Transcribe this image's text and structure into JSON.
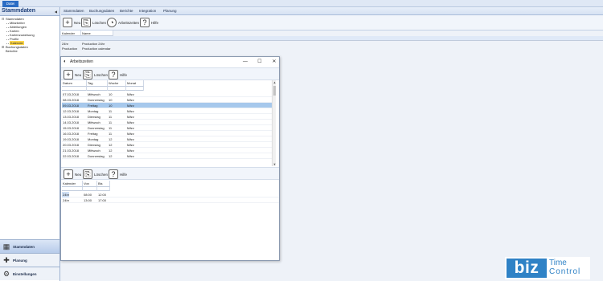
{
  "app": {
    "file_tab": "Datei"
  },
  "nav": {
    "title": "Stammdaten",
    "tree": [
      {
        "label": "Stammdaten",
        "level": 0,
        "expander": "⊟"
      },
      {
        "label": "Mitarbeiter",
        "level": 1
      },
      {
        "label": "Abteilungen",
        "level": 1
      },
      {
        "label": "Karten",
        "level": 1
      },
      {
        "label": "Kartenzuweisung",
        "level": 1
      },
      {
        "label": "Profile",
        "level": 1
      },
      {
        "label": "Kalender",
        "level": 1,
        "selected": true
      },
      {
        "label": "Buchungsdaten",
        "level": 0,
        "expander": "⊞"
      },
      {
        "label": "Berichte",
        "level": 0
      }
    ],
    "buttons": [
      {
        "label": "Stammdaten",
        "icon": "master-data-icon",
        "active": true
      },
      {
        "label": "Planung",
        "icon": "planning-icon"
      },
      {
        "label": "Einstellungen",
        "icon": "settings-icon"
      }
    ]
  },
  "menu": [
    "Stammdaten",
    "Buchungsdaten",
    "Berichte",
    "Integration",
    "Planung"
  ],
  "toolbar": {
    "new_label": "Neu",
    "delete_label": "Löschen",
    "worktimes_label": "Arbeitszeiten",
    "help_label": "Hilfe"
  },
  "grid": {
    "columns": [
      "Kalender",
      "Name"
    ],
    "rows": [
      [
        "24hr",
        "Production 24hr"
      ],
      [
        "Production",
        "Production calendar"
      ]
    ]
  },
  "dialog": {
    "title": "Arbeitszeiten",
    "toolbar": {
      "new_label": "Neu",
      "delete_label": "Löschen",
      "help_label": "Hilfe"
    },
    "days": {
      "columns": [
        "Datum",
        "Tag",
        "Woche",
        "Monat"
      ],
      "rows": [
        [
          "07.03.2018",
          "Mittwoch",
          "10",
          "März"
        ],
        [
          "08.03.2018",
          "Donnerstag",
          "10",
          "März"
        ],
        [
          "09.03.2018",
          "Freitag",
          "10",
          "März"
        ],
        [
          "12.03.2018",
          "Montag",
          "11",
          "März"
        ],
        [
          "13.03.2018",
          "Dienstag",
          "11",
          "März"
        ],
        [
          "14.03.2018",
          "Mittwoch",
          "11",
          "März"
        ],
        [
          "15.03.2018",
          "Donnerstag",
          "11",
          "März"
        ],
        [
          "16.03.2018",
          "Freitag",
          "11",
          "März"
        ],
        [
          "19.03.2018",
          "Montag",
          "12",
          "März"
        ],
        [
          "20.03.2018",
          "Dienstag",
          "12",
          "März"
        ],
        [
          "21.03.2018",
          "Mittwoch",
          "12",
          "März"
        ],
        [
          "22.03.2018",
          "Donnerstag",
          "12",
          "März"
        ]
      ],
      "selected_row": 2
    },
    "toolbar2": {
      "new_label": "Neu",
      "delete_label": "Löschen",
      "help_label": "Hilfe"
    },
    "times": {
      "columns": [
        "Kalender",
        "Von",
        "Bis"
      ],
      "rows": [
        [
          "24hr",
          "08:00",
          "12:00"
        ],
        [
          "24hr",
          "13:00",
          "17:00"
        ]
      ]
    }
  },
  "brand": {
    "biz": "biz",
    "time": "Time",
    "control": "Control"
  },
  "colors": {
    "accent": "#2b6cc4",
    "selection": "#a6c8ec",
    "tree_selection": "#ffd84a",
    "brand": "#2f82c6"
  }
}
